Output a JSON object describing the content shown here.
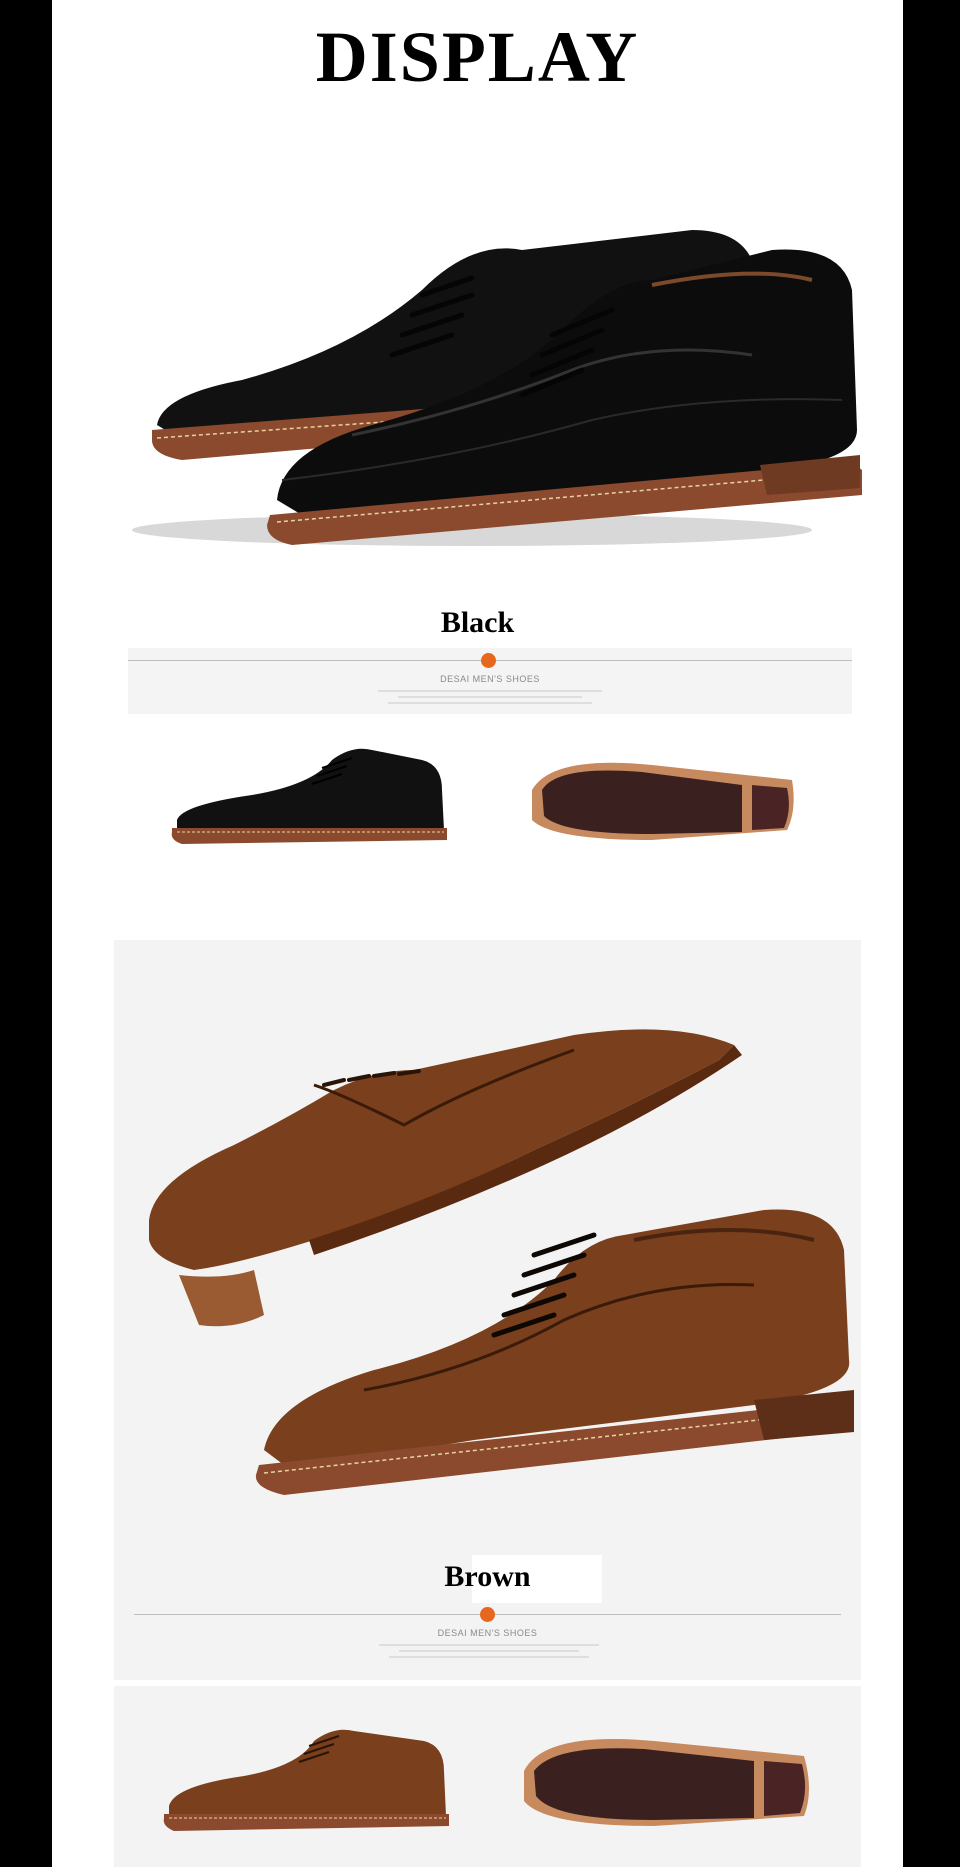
{
  "title": "DISPLAY",
  "variants": [
    {
      "label": "Black",
      "brand": "DESAI MEN'S SHOES",
      "leather": "#141414",
      "sole": "#8b4a2e"
    },
    {
      "label": "Brown",
      "brand": "DESAI MEN'S SHOES",
      "leather": "#7a3f1c",
      "sole": "#8b4a2e"
    }
  ],
  "colors": {
    "accent": "#e8671f",
    "page_bg": "#ffffff",
    "side_bars": "#000000"
  }
}
